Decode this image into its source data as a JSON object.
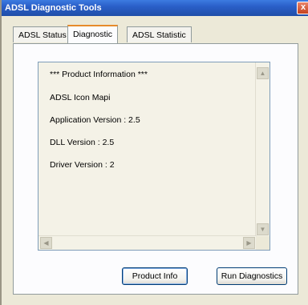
{
  "window": {
    "title": "ADSL Diagnostic Tools",
    "close_glyph": "x"
  },
  "tabs": [
    {
      "label": "ADSL Status"
    },
    {
      "label": "Diagnostic"
    },
    {
      "label": "ADSL Statistic"
    }
  ],
  "active_tab": "Diagnostic",
  "info_lines": [
    "*** Product Information ***",
    "ADSL Icon Mapi",
    "Application Version : 2.5",
    "DLL Version : 2.5",
    "Driver Version : 2"
  ],
  "buttons": {
    "product_info": "Product Info",
    "run_diagnostics": "Run Diagnostics"
  },
  "scroll_glyphs": {
    "up": "▲",
    "down": "▼",
    "left": "◀",
    "right": "▶"
  }
}
